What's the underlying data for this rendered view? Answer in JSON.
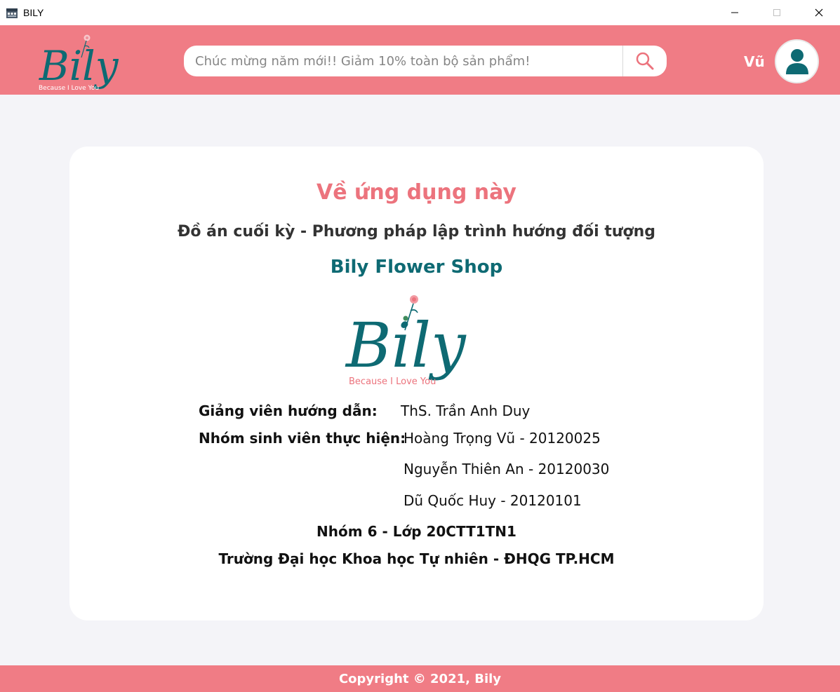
{
  "window": {
    "title": "BILY"
  },
  "header": {
    "logo_text": "Bily",
    "logo_tagline": "Because I Love You",
    "search_placeholder": "Chúc mừng năm mới!! Giảm 10% toàn bộ sản phẩm!",
    "search_icon": "search-icon",
    "user_name": "Vũ",
    "avatar_icon": "user-icon"
  },
  "about": {
    "title": "Về ứng dụng này",
    "subtitle": "Đồ án cuối kỳ - Phương pháp lập trình hướng đối tượng",
    "shop_name": "Bily Flower Shop",
    "logo_text": "Bily",
    "logo_tagline": "Because I Love You",
    "instructor_label": "Giảng viên hướng dẫn:",
    "instructor_name": "ThS. Trần Anh Duy",
    "students_label": "Nhóm sinh viên thực hiện:",
    "students": [
      "Hoàng Trọng Vũ - 20120025",
      "Nguyễn Thiên An - 20120030",
      "Dũ Quốc Huy - 20120101"
    ],
    "group_class": "Nhóm 6 - Lớp 20CTT1TN1",
    "university": "Trường Đại học Khoa học Tự nhiên - ĐHQG TP.HCM"
  },
  "footer": {
    "copyright": "Copyright © 2021, Bily"
  },
  "colors": {
    "brand_pink": "#f07c85",
    "brand_teal": "#0e6a73",
    "title_pink": "#ec737d",
    "background": "#f4f4f8"
  }
}
